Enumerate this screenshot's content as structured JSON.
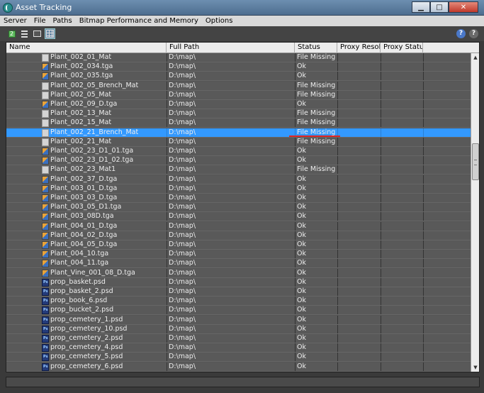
{
  "window": {
    "title": "Asset Tracking",
    "minimize": "▁",
    "maximize": "□",
    "close": "✕"
  },
  "menu": [
    "Server",
    "File",
    "Paths",
    "Bitmap Performance and Memory",
    "Options"
  ],
  "toolbar": {
    "refresh_glyph": "2",
    "help_glyph": "?"
  },
  "columns": [
    "Name",
    "Full Path",
    "Status",
    "Proxy Resol...",
    "Proxy Status"
  ],
  "selected_index": 8,
  "rows": [
    {
      "icon": "mat",
      "name": "Plant_002_01_Mat",
      "path": "D:\\map\\",
      "status": "File Missing"
    },
    {
      "icon": "tga",
      "name": "Plant_002_034.tga",
      "path": "D:\\map\\",
      "status": "Ok"
    },
    {
      "icon": "tga",
      "name": "Plant_002_035.tga",
      "path": "D:\\map\\",
      "status": "Ok"
    },
    {
      "icon": "mat",
      "name": "Plant_002_05_Brench_Mat",
      "path": "D:\\map\\",
      "status": "File Missing"
    },
    {
      "icon": "mat",
      "name": "Plant_002_05_Mat",
      "path": "D:\\map\\",
      "status": "File Missing"
    },
    {
      "icon": "tga",
      "name": "Plant_002_09_D.tga",
      "path": "D:\\map\\",
      "status": "Ok"
    },
    {
      "icon": "mat",
      "name": "Plant_002_13_Mat",
      "path": "D:\\map\\",
      "status": "File Missing"
    },
    {
      "icon": "mat",
      "name": "Plant_002_15_Mat",
      "path": "D:\\map\\",
      "status": "File Missing"
    },
    {
      "icon": "mat",
      "name": "Plant_002_21_Brench_Mat",
      "path": "D:\\map\\",
      "status": "File Missing"
    },
    {
      "icon": "mat",
      "name": "Plant_002_21_Mat",
      "path": "D:\\map\\",
      "status": "File Missing"
    },
    {
      "icon": "tga",
      "name": "Plant_002_23_D1_01.tga",
      "path": "D:\\map\\",
      "status": "Ok"
    },
    {
      "icon": "tga",
      "name": "Plant_002_23_D1_02.tga",
      "path": "D:\\map\\",
      "status": "Ok"
    },
    {
      "icon": "mat",
      "name": "Plant_002_23_Mat1",
      "path": "D:\\map\\",
      "status": "File Missing"
    },
    {
      "icon": "tga",
      "name": "Plant_002_37_D.tga",
      "path": "D:\\map\\",
      "status": "Ok"
    },
    {
      "icon": "tga",
      "name": "Plant_003_01_D.tga",
      "path": "D:\\map\\",
      "status": "Ok"
    },
    {
      "icon": "tga",
      "name": "Plant_003_03_D.tga",
      "path": "D:\\map\\",
      "status": "Ok"
    },
    {
      "icon": "tga",
      "name": "Plant_003_05_D1.tga",
      "path": "D:\\map\\",
      "status": "Ok"
    },
    {
      "icon": "tga",
      "name": "Plant_003_08D.tga",
      "path": "D:\\map\\",
      "status": "Ok"
    },
    {
      "icon": "tga",
      "name": "Plant_004_01_D.tga",
      "path": "D:\\map\\",
      "status": "Ok"
    },
    {
      "icon": "tga",
      "name": "Plant_004_02_D.tga",
      "path": "D:\\map\\",
      "status": "Ok"
    },
    {
      "icon": "tga",
      "name": "Plant_004_05_D.tga",
      "path": "D:\\map\\",
      "status": "Ok"
    },
    {
      "icon": "tga",
      "name": "Plant_004_10.tga",
      "path": "D:\\map\\",
      "status": "Ok"
    },
    {
      "icon": "tga",
      "name": "Plant_004_11.tga",
      "path": "D:\\map\\",
      "status": "Ok"
    },
    {
      "icon": "tga",
      "name": "Plant_Vine_001_08_D.tga",
      "path": "D:\\map\\",
      "status": "Ok"
    },
    {
      "icon": "psd",
      "name": "prop_basket.psd",
      "path": "D:\\map\\",
      "status": "Ok"
    },
    {
      "icon": "psd",
      "name": "prop_basket_2.psd",
      "path": "D:\\map\\",
      "status": "Ok"
    },
    {
      "icon": "psd",
      "name": "prop_book_6.psd",
      "path": "D:\\map\\",
      "status": "Ok"
    },
    {
      "icon": "psd",
      "name": "prop_bucket_2.psd",
      "path": "D:\\map\\",
      "status": "Ok"
    },
    {
      "icon": "psd",
      "name": "prop_cemetery_1.psd",
      "path": "D:\\map\\",
      "status": "Ok"
    },
    {
      "icon": "psd",
      "name": "prop_cemetery_10.psd",
      "path": "D:\\map\\",
      "status": "Ok"
    },
    {
      "icon": "psd",
      "name": "prop_cemetery_2.psd",
      "path": "D:\\map\\",
      "status": "Ok"
    },
    {
      "icon": "psd",
      "name": "prop_cemetery_4.psd",
      "path": "D:\\map\\",
      "status": "Ok"
    },
    {
      "icon": "psd",
      "name": "prop_cemetery_5.psd",
      "path": "D:\\map\\",
      "status": "Ok"
    },
    {
      "icon": "psd",
      "name": "prop_cemetery_6.psd",
      "path": "D:\\map\\",
      "status": "Ok"
    }
  ],
  "colors": {
    "selection": "#3399ff",
    "annotation": "#e02424"
  }
}
